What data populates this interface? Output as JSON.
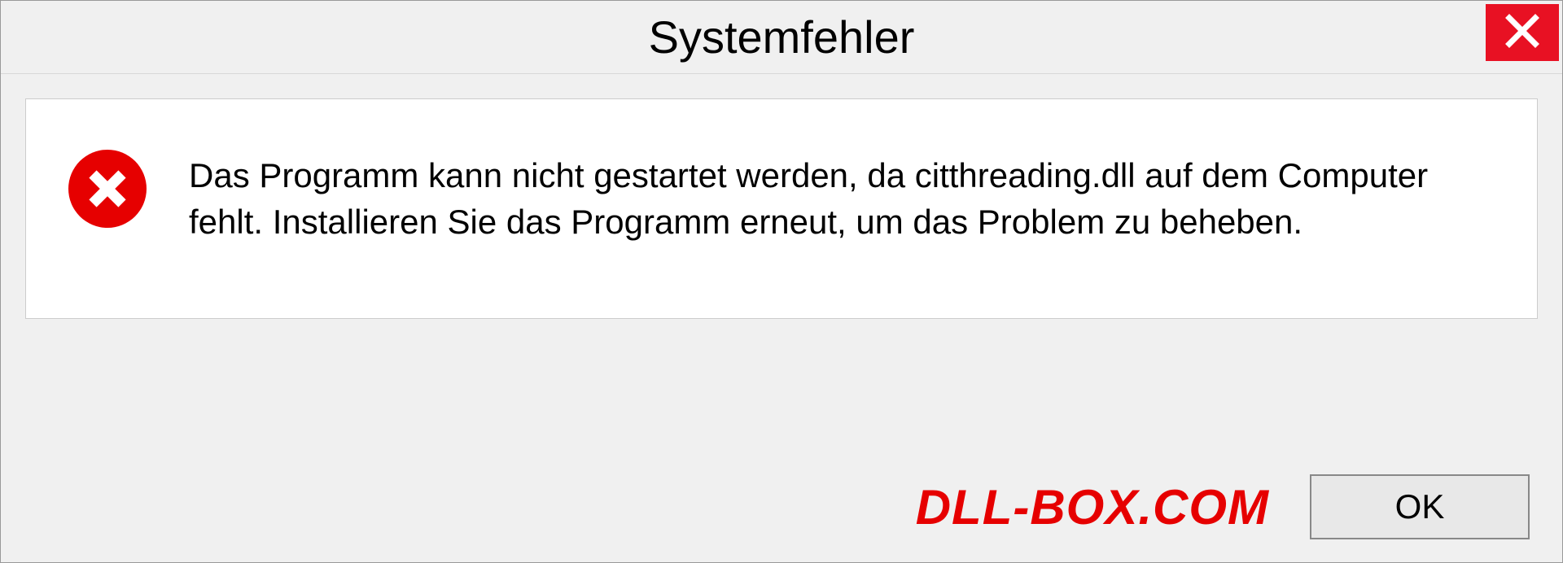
{
  "titlebar": {
    "title": "Systemfehler"
  },
  "message": {
    "text": "Das Programm kann nicht gestartet werden, da citthreading.dll auf dem Computer fehlt. Installieren Sie das Programm erneut, um das Problem zu beheben."
  },
  "footer": {
    "watermark": "DLL-BOX.COM",
    "ok_label": "OK"
  },
  "colors": {
    "error_red": "#e60000",
    "close_red": "#e81123"
  }
}
